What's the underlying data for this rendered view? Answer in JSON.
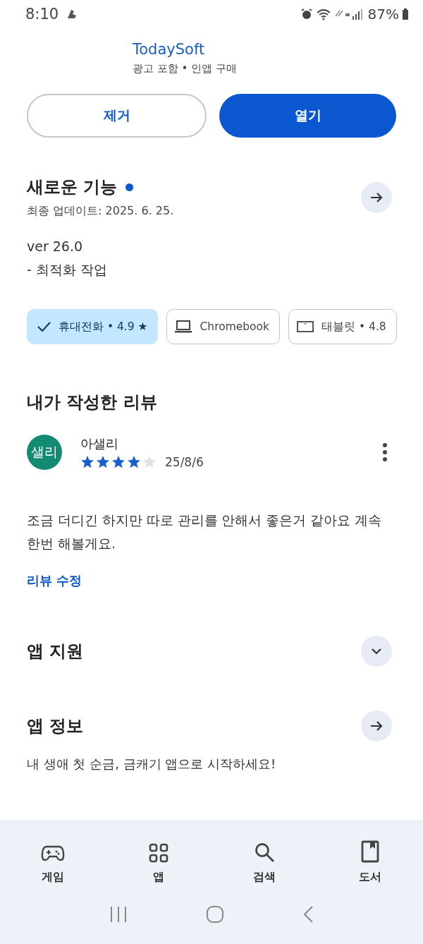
{
  "status_bar": {
    "time": "8:10",
    "battery": "87%"
  },
  "app": {
    "developer": "TodaySoft",
    "meta": "광고 포함 • 인앱 구매"
  },
  "actions": [
    {
      "label": "제거",
      "kind": "outline"
    },
    {
      "label": "열기",
      "kind": "filled"
    }
  ],
  "whats_new": {
    "title": "새로운 기능",
    "new_dot": true,
    "updated": "최종 업데이트: 2025. 6. 25.",
    "version": "ver 26.0",
    "notes": "- 최적화 작업"
  },
  "devices": [
    {
      "label": "휴대전화 • 4.9 ★",
      "kind": "phone",
      "selected": true
    },
    {
      "label": "Chromebook",
      "kind": "laptop",
      "selected": false
    },
    {
      "label": "태블릿 • 4.8",
      "kind": "tablet",
      "selected": false
    }
  ],
  "my_review": {
    "title": "내가 작성한 리뷰",
    "avatar": "샐리",
    "author": "아샐리",
    "stars": 4,
    "date": "25/8/6",
    "text": "조금 더디긴 하지만 따로 관리를 안해서 좋은거 같아요 계속 한번 해볼게요.",
    "edit_link": "리뷰 수정"
  },
  "sections": [
    {
      "title": "앱 지원",
      "kind": "expand"
    },
    {
      "title": "앱 정보",
      "kind": "arrow",
      "description": "내 생애 첫 순금, 금캐기 앱으로 시작하세요!"
    }
  ],
  "bottom_nav": [
    {
      "label": "게임",
      "kind": "games"
    },
    {
      "label": "앱",
      "kind": "apps"
    },
    {
      "label": "검색",
      "kind": "search"
    },
    {
      "label": "도서",
      "kind": "books"
    }
  ]
}
